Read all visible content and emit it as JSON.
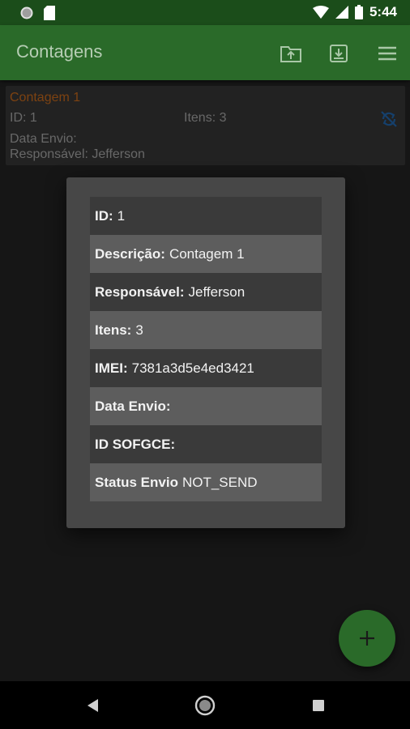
{
  "status_bar": {
    "time": "5:44"
  },
  "app_bar": {
    "title": "Contagens",
    "icons": [
      "upload-folder-icon",
      "download-archive-icon",
      "menu-icon"
    ]
  },
  "card": {
    "title": "Contagem 1",
    "id": "ID: 1",
    "itens": "Itens: 3",
    "data_envio": "Data Envio:",
    "responsavel": "Responsável: Jefferson",
    "icon": "sync-disabled-icon"
  },
  "dialog": {
    "rows": [
      {
        "key": "ID:",
        "value": "1"
      },
      {
        "key": "Descrição:",
        "value": "Contagem 1"
      },
      {
        "key": "Responsável:",
        "value": "Jefferson"
      },
      {
        "key": "Itens:",
        "value": "3"
      },
      {
        "key": "IMEI:",
        "value": "7381a3d5e4ed3421"
      },
      {
        "key": "Data Envio:",
        "value": ""
      },
      {
        "key": "ID SOFGCE:",
        "value": ""
      },
      {
        "key": "Status Envio",
        "value": "NOT_SEND"
      }
    ]
  },
  "fab": {
    "icon": "plus-icon"
  },
  "nav_bar": {
    "icons": [
      "back-icon",
      "home-icon",
      "recents-icon"
    ]
  },
  "colors": {
    "primary": "#2a6a29",
    "primary_dark": "#1b4d1a",
    "accent_text": "#b8621a",
    "sync_icon": "#1f5fa0"
  }
}
